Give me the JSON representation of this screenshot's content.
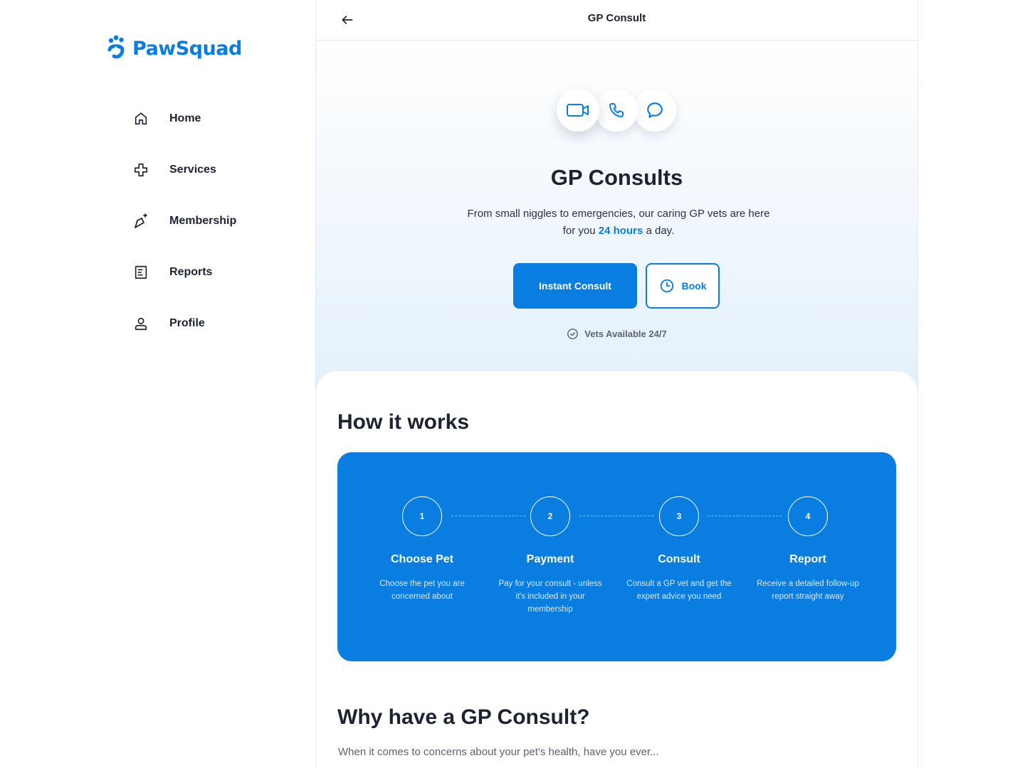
{
  "brand": {
    "name": "PawSquad",
    "color": "#0a7ee0"
  },
  "sidebar": {
    "items": [
      {
        "label": "Home",
        "icon": "home-icon"
      },
      {
        "label": "Services",
        "icon": "medical-cross-icon"
      },
      {
        "label": "Membership",
        "icon": "sparkle-icon"
      },
      {
        "label": "Reports",
        "icon": "report-icon"
      },
      {
        "label": "Profile",
        "icon": "user-icon"
      }
    ]
  },
  "topbar": {
    "title": "GP Consult",
    "back_icon": "arrow-left-icon"
  },
  "hero": {
    "channels": [
      "video-icon",
      "phone-icon",
      "chat-icon"
    ],
    "title": "GP Consults",
    "subtitle_before": "From small niggles to emergencies, our caring GP vets are here for you ",
    "subtitle_highlight": "24 hours",
    "subtitle_after": " a day.",
    "primary_button": "Instant Consult",
    "secondary_button": "Book",
    "secondary_icon": "clock-icon",
    "availability": "Vets Available 24/7",
    "availability_icon": "check-circle-icon"
  },
  "how_it_works": {
    "title": "How it works",
    "steps": [
      {
        "number": "1",
        "title": "Choose Pet",
        "description": "Choose the pet you are concerned about"
      },
      {
        "number": "2",
        "title": "Payment",
        "description": "Pay for your consult - unless it's included in your membership"
      },
      {
        "number": "3",
        "title": "Consult",
        "description": "Consult a GP vet and get the expert advice you need"
      },
      {
        "number": "4",
        "title": "Report",
        "description": "Receive a detailed follow-up report straight away"
      }
    ]
  },
  "why": {
    "title": "Why have a GP Consult?",
    "subtitle": "When it comes to concerns about your pet's health, have you ever..."
  }
}
